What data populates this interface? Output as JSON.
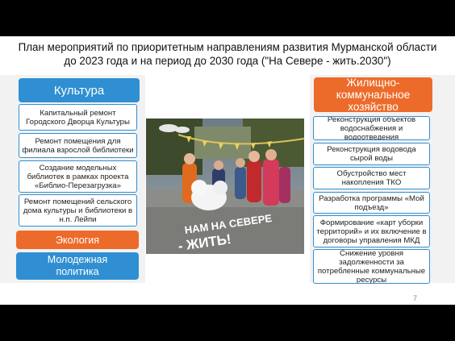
{
  "title": "План мероприятий по приоритетным направлениям развития Мурманской области до 2023 года и на период до 2030 года (\"На Севере - жить.2030\")",
  "left": {
    "culture": {
      "label": "Культура",
      "items": [
        "Капитальный ремонт Городского Дворца Культуры",
        "Ремонт помещения для филиала взрослой библиотеки",
        "Создание модельных библиотек в рамках проекта «Библио-Перезагрузка»",
        "Ремонт помещений сельского дома культуры и библиотеки в н.п. Лейпи"
      ]
    },
    "ecology": {
      "label": "Экология"
    },
    "youth": {
      "label": "Молодежная политика"
    }
  },
  "right": {
    "housing": {
      "label": "Жилищно-коммунальное хозяйство",
      "items": [
        "Реконструкция объектов водоснабжения и водоотведения",
        "Реконструкция водовода сырой воды",
        "Обустройство мест накопления ТКО",
        "Разработка программы «Мой подъезд»",
        "Формирование «карт уборки территорий» и их включение в договоры управления МКД",
        "Снижение уровня задолженности за потребленные коммунальные ресурсы"
      ]
    }
  },
  "photo": {
    "sign_line1": "НАМ НА СЕВЕРЕ",
    "sign_line2": "- ЖИТЬ!"
  },
  "page_number": "7",
  "colors": {
    "blue": "#2f8fd2",
    "orange": "#ed6b2a"
  }
}
